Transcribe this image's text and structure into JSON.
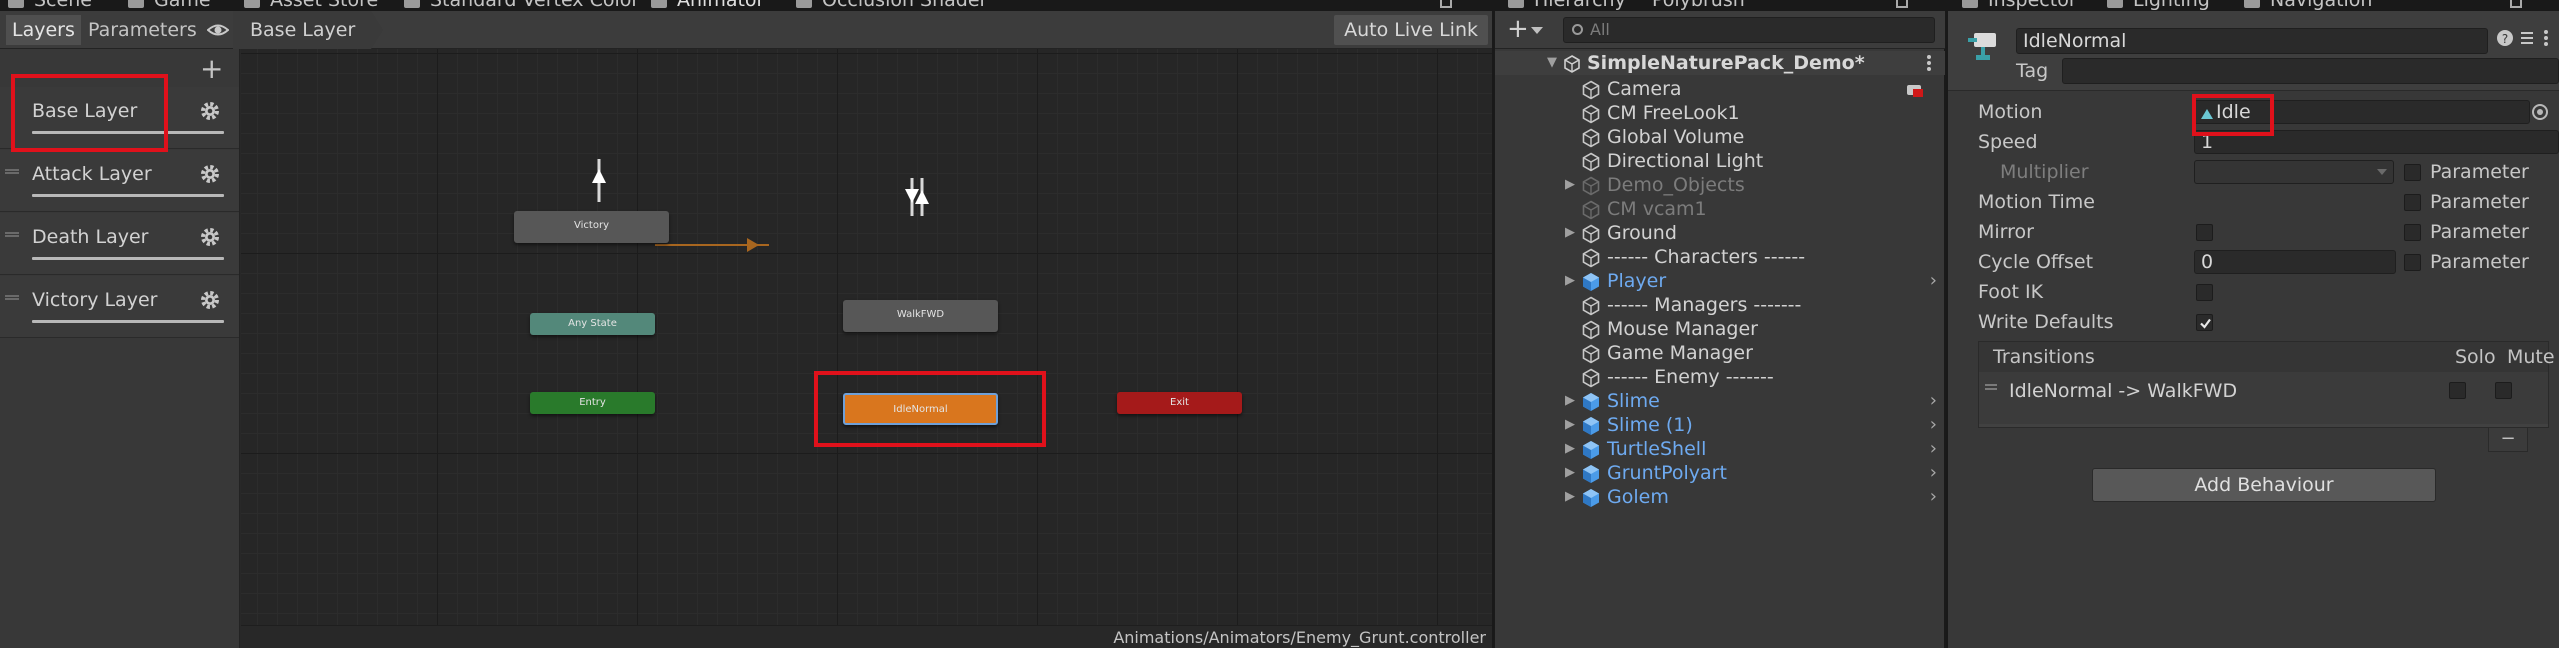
{
  "colors": {
    "accent_orange": "#d9761e",
    "highlight_red": "#e0111b",
    "prefab_blue": "#6eaaf0",
    "anystate_teal": "#53887a",
    "entry_green": "#297a2b",
    "exit_red": "#a51a1a",
    "node_gray": "#575757"
  },
  "top_tabs": {
    "scene": "Scene",
    "game": "Game",
    "asset_store": "Asset Store",
    "standard_vertex": "Standard Vertex Color",
    "animator": "Animator",
    "occlusion": "Occlusion Shader",
    "hierarchy": "Hierarchy",
    "polybrush": "Polybrush",
    "inspector": "Inspector",
    "lighting": "Lighting",
    "navigation": "Navigation"
  },
  "animator": {
    "tab_layers": "Layers",
    "tab_parameters": "Parameters",
    "breadcrumb": "Base Layer",
    "auto_live_link": "Auto Live Link",
    "layers": [
      {
        "name": "Base Layer"
      },
      {
        "name": "Attack Layer"
      },
      {
        "name": "Death Layer"
      },
      {
        "name": "Victory Layer"
      }
    ],
    "states": {
      "victory": "Victory",
      "any_state": "Any State",
      "entry": "Entry",
      "walkfwd": "WalkFWD",
      "idlenormal": "IdleNormal",
      "exit": "Exit"
    },
    "controller_path": "Animations/Animators/Enemy_Grunt.controller"
  },
  "hierarchy": {
    "search_placeholder": "All",
    "root": "SimpleNaturePack_Demo*",
    "items": [
      {
        "label": "Camera"
      },
      {
        "label": "CM FreeLook1"
      },
      {
        "label": "Global Volume"
      },
      {
        "label": "Directional Light"
      },
      {
        "label": "Demo_Objects"
      },
      {
        "label": "CM vcam1"
      },
      {
        "label": "Ground"
      },
      {
        "label": "------ Characters ------"
      },
      {
        "label": "Player"
      },
      {
        "label": "------ Managers -------"
      },
      {
        "label": "Mouse Manager"
      },
      {
        "label": "Game Manager"
      },
      {
        "label": "------ Enemy -------"
      },
      {
        "label": "Slime"
      },
      {
        "label": "Slime (1)"
      },
      {
        "label": "TurtleShell"
      },
      {
        "label": "GruntPolyart"
      },
      {
        "label": "Golem"
      }
    ]
  },
  "inspector": {
    "name": "IdleNormal",
    "tag_label": "Tag",
    "motion_label": "Motion",
    "motion_value": "Idle",
    "speed_label": "Speed",
    "speed_value": "1",
    "multiplier_label": "Multiplier",
    "parameter_label": "Parameter",
    "motion_time_label": "Motion Time",
    "mirror_label": "Mirror",
    "cycle_offset_label": "Cycle Offset",
    "cycle_offset_value": "0",
    "foot_ik_label": "Foot IK",
    "write_defaults_label": "Write Defaults",
    "write_defaults_checked": true,
    "transitions_label": "Transitions",
    "solo_label": "Solo",
    "mute_label": "Mute",
    "transition": "IdleNormal -> WalkFWD",
    "minus": "−",
    "add_behaviour": "Add Behaviour"
  }
}
